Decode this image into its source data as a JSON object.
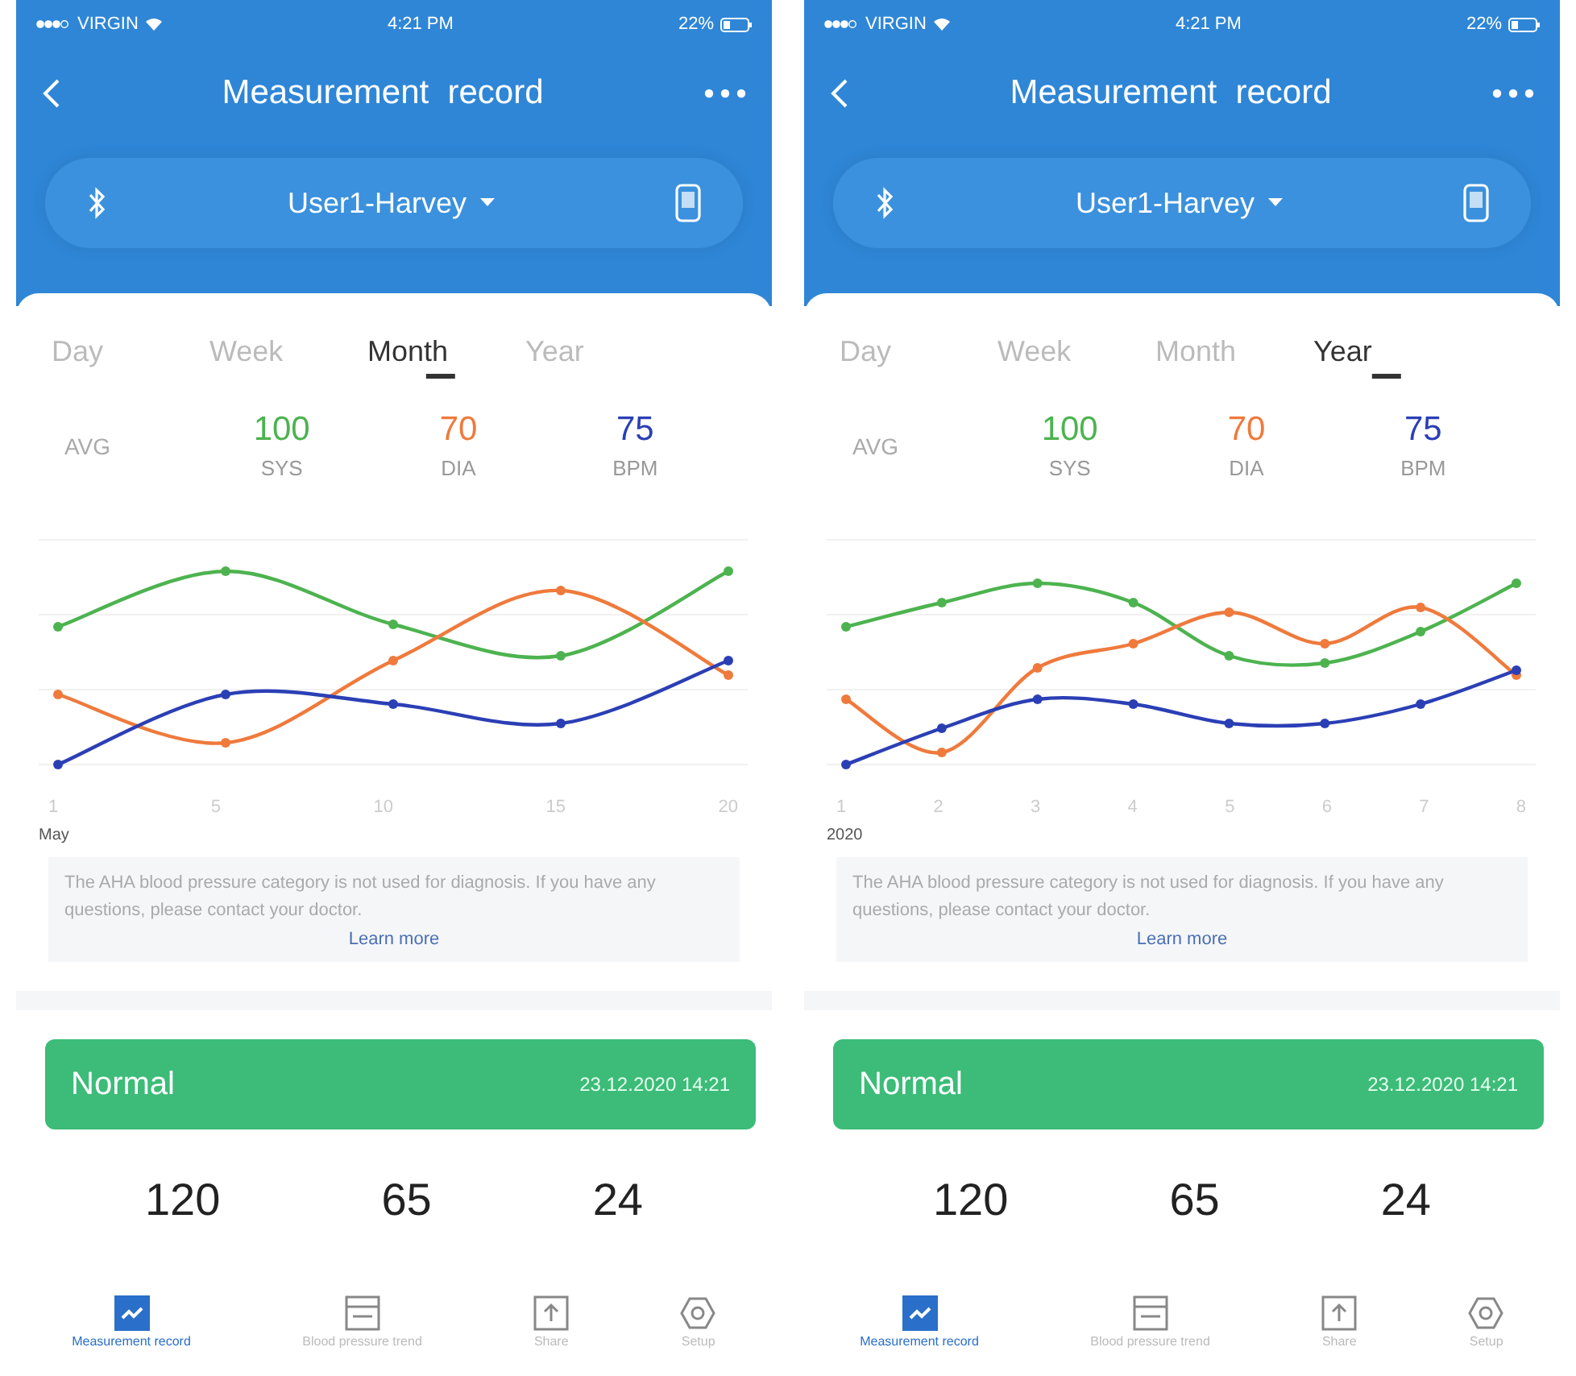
{
  "screens": [
    {
      "status_bar": {
        "carrier": "VIRGIN",
        "time": "4:21 PM",
        "battery": "22%"
      },
      "title": "Measurement  record",
      "user": "User1-Harvey",
      "tabs": [
        {
          "label": "Day",
          "selected": false
        },
        {
          "label": "Week",
          "selected": false
        },
        {
          "label": "Month",
          "selected": true
        },
        {
          "label": "Year",
          "selected": false
        }
      ],
      "avg_label": "AVG",
      "averages": [
        {
          "value": "100",
          "label": "SYS",
          "color": "#4db34f"
        },
        {
          "value": "70",
          "label": "DIA",
          "color": "#ef7a3c"
        },
        {
          "value": "75",
          "label": "BPM",
          "color": "#2b3fb5"
        }
      ],
      "chart": {
        "x_labels": [
          "1",
          "5",
          "10",
          "15",
          "20"
        ],
        "period": "May"
      },
      "notice": {
        "text": "The AHA blood pressure category is not used for diagnosis. If you have any questions, please contact your doctor.",
        "link": "Learn more"
      },
      "latest": {
        "status": "Normal",
        "datetime": "23.12.2020 14:21",
        "values": [
          "120",
          "65",
          "24"
        ]
      },
      "nav": [
        {
          "label": "Measurement record",
          "selected": true
        },
        {
          "label": "Blood pressure trend",
          "selected": false
        },
        {
          "label": "Share",
          "selected": false
        },
        {
          "label": "Setup",
          "selected": false
        }
      ]
    },
    {
      "status_bar": {
        "carrier": "VIRGIN",
        "time": "4:21 PM",
        "battery": "22%"
      },
      "title": "Measurement  record",
      "user": "User1-Harvey",
      "tabs": [
        {
          "label": "Day",
          "selected": false
        },
        {
          "label": "Week",
          "selected": false
        },
        {
          "label": "Month",
          "selected": false
        },
        {
          "label": "Year",
          "selected": true
        }
      ],
      "avg_label": "AVG",
      "averages": [
        {
          "value": "100",
          "label": "SYS",
          "color": "#4db34f"
        },
        {
          "value": "70",
          "label": "DIA",
          "color": "#ef7a3c"
        },
        {
          "value": "75",
          "label": "BPM",
          "color": "#2b3fb5"
        }
      ],
      "chart": {
        "x_labels": [
          "1",
          "2",
          "3",
          "4",
          "5",
          "6",
          "7",
          "8"
        ],
        "period": "2020"
      },
      "notice": {
        "text": "The AHA blood pressure category is not used for diagnosis. If you have any questions, please contact your doctor.",
        "link": "Learn more"
      },
      "latest": {
        "status": "Normal",
        "datetime": "23.12.2020 14:21",
        "values": [
          "120",
          "65",
          "24"
        ]
      },
      "nav": [
        {
          "label": "Measurement record",
          "selected": true
        },
        {
          "label": "Blood pressure trend",
          "selected": false
        },
        {
          "label": "Share",
          "selected": false
        },
        {
          "label": "Setup",
          "selected": false
        }
      ]
    }
  ]
}
